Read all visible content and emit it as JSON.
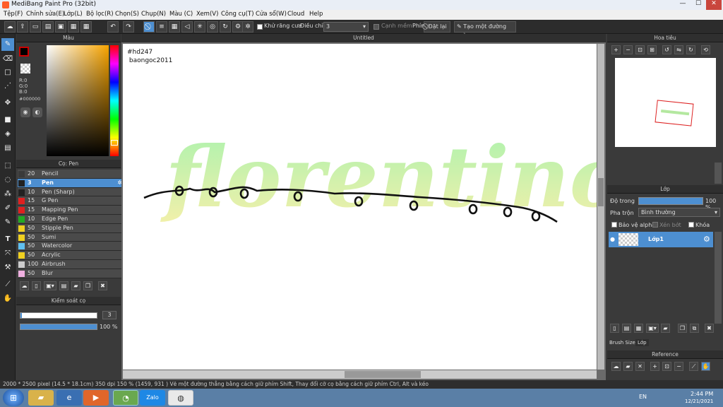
{
  "window": {
    "title": "MediBang Paint Pro (32bit)",
    "min": "—",
    "max": "☐",
    "close": "✕"
  },
  "menu": [
    "Tệp(F)",
    "Chỉnh sửa(E)",
    "Lớp(L)",
    "Bộ lọc(R)",
    "Chọn(S)",
    "Chụp(N)",
    "Màu (C)",
    "Xem(V)",
    "Công cụ(T)",
    "Cửa sổ(W)",
    "Cloud",
    "Help"
  ],
  "toolbar": {
    "antialias": "Khử răng cưa",
    "adjust": "Điều chỉnh",
    "adjust_value": "3",
    "smooth": "Cạnh mềm",
    "key": "Phím",
    "reset": "Đặt lại",
    "straight": "Tạo một đường thẳng"
  },
  "color_panel": {
    "title": "Màu",
    "r": "R:0",
    "g": "G:0",
    "b": "B:0",
    "hex": "#000000"
  },
  "brush_panel": {
    "title": "Cọ: Pen",
    "items": [
      {
        "size": "20",
        "name": "Pencil",
        "color": "#3a3a3a"
      },
      {
        "size": "3",
        "name": "Pen",
        "color": "#222222"
      },
      {
        "size": "10",
        "name": "Pen (Sharp)",
        "color": "#222222"
      },
      {
        "size": "15",
        "name": "G Pen",
        "color": "#e02020"
      },
      {
        "size": "15",
        "name": "Mapping Pen",
        "color": "#e02020"
      },
      {
        "size": "10",
        "name": "Edge Pen",
        "color": "#22aa22"
      },
      {
        "size": "50",
        "name": "Stipple Pen",
        "color": "#f0d020"
      },
      {
        "size": "50",
        "name": "Sumi",
        "color": "#f0d020"
      },
      {
        "size": "50",
        "name": "Watercolor",
        "color": "#60c0f0"
      },
      {
        "size": "50",
        "name": "Acrylic",
        "color": "#f0d020"
      },
      {
        "size": "100",
        "name": "Airbrush",
        "color": "#cccccc"
      },
      {
        "size": "50",
        "name": "Blur",
        "color": "#f0b0e0"
      }
    ]
  },
  "brush_control": {
    "title": "Kiểm soát cọ",
    "size": "3",
    "opacity": "100 %",
    "size_fraction": 0.02,
    "opacity_fraction": 1.0
  },
  "canvas": {
    "title": "Untitled",
    "line1": "#hd247",
    "line2": "baongoc2011"
  },
  "navigator": {
    "title": "Hoa tiêu"
  },
  "layer": {
    "title": "Lớp",
    "opacity_label": "Độ trong",
    "opacity": "100 %",
    "opacity_fraction": 1.0,
    "blend_label": "Pha trộn",
    "blend": "Bình thường",
    "alpha": "Bảo vệ alpha",
    "clip": "Xén bớt",
    "lock": "Khóa",
    "layer_name": "Lớp1"
  },
  "bottom_tabs": {
    "brush_size": "Brush Size",
    "layer": "Lớp"
  },
  "reference": {
    "title": "Reference"
  },
  "status": "2000 * 2500 pixel   (14.5 * 18.1cm)   350 dpi   150 %   (1459, 931 )   Vẽ một đường thẳng bằng cách giữ phím Shift, Thay đổi cỡ cọ bằng cách giữ phím Ctrl, Alt và kéo",
  "taskbar": {
    "lang": "EN",
    "time": "2:44 PM",
    "date": "12/21/2021",
    "zalo": "Zalo"
  }
}
